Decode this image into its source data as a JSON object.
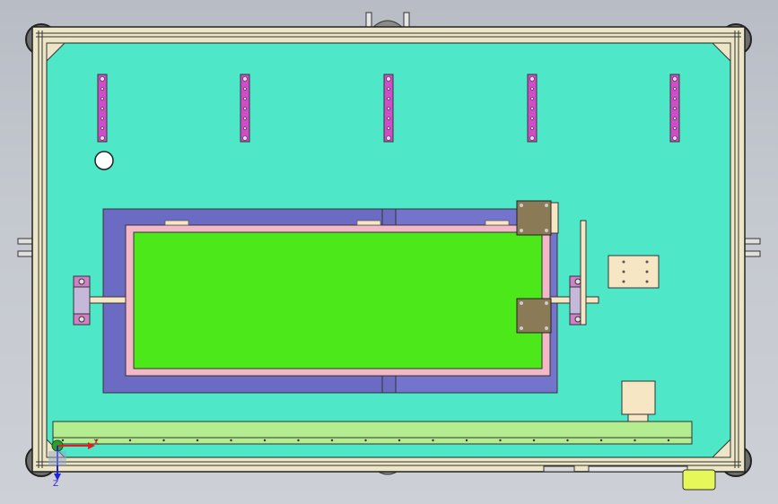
{
  "viewport": {
    "background": "#c4c8cf",
    "axes": {
      "x_label": "X",
      "y_label": "Z"
    }
  },
  "colors": {
    "table_surface": "#4ee8c8",
    "frame_profile": "#ece6c6",
    "frame_dark": "#2a2a2a",
    "blue_tray": "#6b6bc4",
    "pink_border": "#f3b8c8",
    "green_panel": "#4ce81a",
    "magenta_bracket": "#d04cc8",
    "tan_part": "#f7e6c4",
    "olive_block": "#8a7a56",
    "bottom_rail": "#b4ec90",
    "yellow_part": "#e6f75a",
    "caster": "#808080",
    "axis_x": "#e02020",
    "axis_y": "#20c020",
    "axis_z": "#2020e0"
  },
  "parts": {
    "brackets": [
      "vertical-bracket",
      "vertical-bracket",
      "vertical-bracket",
      "vertical-bracket",
      "vertical-bracket"
    ],
    "casters": [
      "caster-top-left",
      "caster-top-right",
      "caster-bottom-left",
      "caster-bottom-right"
    ],
    "icons": [
      "caster-icon",
      "axis-triad-icon",
      "hole-marker-icon"
    ]
  }
}
